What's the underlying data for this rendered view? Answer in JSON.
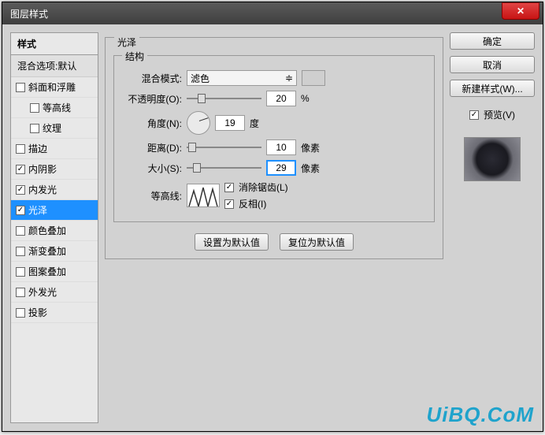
{
  "window": {
    "title": "图层样式"
  },
  "sidebar": {
    "header": "样式",
    "blending": "混合选项:默认",
    "items": [
      {
        "label": "斜面和浮雕",
        "checked": false,
        "indent": false
      },
      {
        "label": "等高线",
        "checked": false,
        "indent": true
      },
      {
        "label": "纹理",
        "checked": false,
        "indent": true
      },
      {
        "label": "描边",
        "checked": false,
        "indent": false
      },
      {
        "label": "内阴影",
        "checked": true,
        "indent": false
      },
      {
        "label": "内发光",
        "checked": true,
        "indent": false
      },
      {
        "label": "光泽",
        "checked": true,
        "indent": false,
        "selected": true
      },
      {
        "label": "颜色叠加",
        "checked": false,
        "indent": false
      },
      {
        "label": "渐变叠加",
        "checked": false,
        "indent": false
      },
      {
        "label": "图案叠加",
        "checked": false,
        "indent": false
      },
      {
        "label": "外发光",
        "checked": false,
        "indent": false
      },
      {
        "label": "投影",
        "checked": false,
        "indent": false
      }
    ]
  },
  "panel": {
    "title": "光泽",
    "structure": "结构",
    "blend_mode_label": "混合模式:",
    "blend_mode_value": "滤色",
    "opacity_label": "不透明度(O):",
    "opacity_value": "20",
    "percent": "%",
    "angle_label": "角度(N):",
    "angle_value": "19",
    "degree": "度",
    "distance_label": "距离(D):",
    "distance_value": "10",
    "pixels": "像素",
    "size_label": "大小(S):",
    "size_value": "29",
    "contour_label": "等高线:",
    "antialias_label": "消除锯齿(L)",
    "invert_label": "反相(I)",
    "set_default": "设置为默认值",
    "reset_default": "复位为默认值"
  },
  "right": {
    "ok": "确定",
    "cancel": "取消",
    "new_style": "新建样式(W)...",
    "preview": "预览(V)"
  },
  "watermark": "UiBQ.CoM"
}
